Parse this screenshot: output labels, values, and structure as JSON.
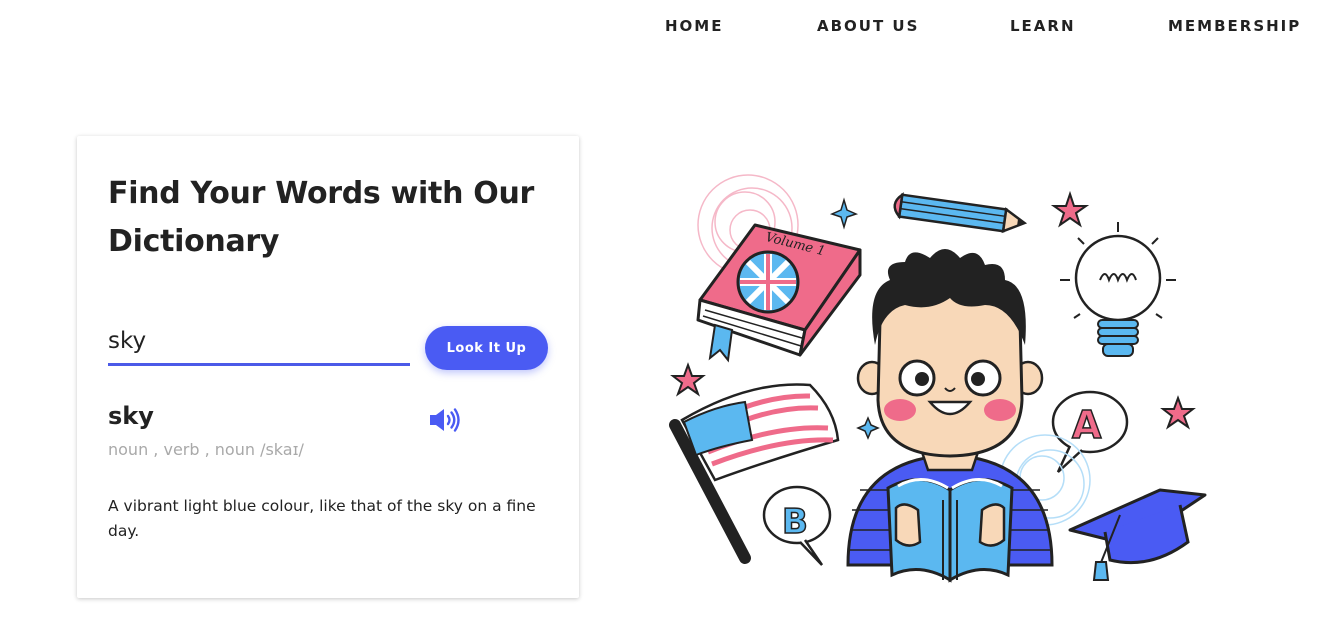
{
  "nav": {
    "items": [
      {
        "label": "HOME"
      },
      {
        "label": "ABOUT US"
      },
      {
        "label": "LEARN"
      },
      {
        "label": "MEMBERSHIP"
      }
    ]
  },
  "card": {
    "title": "Find Your Words with Our Dictionary",
    "search": {
      "value": "sky"
    },
    "button_label": "Look It Up",
    "result": {
      "word": "sky",
      "phonetic": "noun , verb , noun /skaɪ/",
      "definition": "A vibrant light blue colour, like that of the sky on a fine day."
    }
  },
  "illustration": {
    "book_label": "Volume 1",
    "bubble_a": "A",
    "bubble_b": "B"
  },
  "icons": {
    "speaker": "speaker-icon"
  },
  "colors": {
    "accent": "#4a5bf3",
    "underline": "#4b5ae8",
    "muted_text": "#a9a9a9",
    "pink": "#ef6b8a",
    "light_blue": "#5bb8f0"
  }
}
